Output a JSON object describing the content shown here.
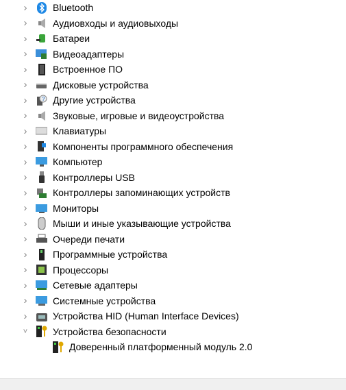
{
  "tree": {
    "categories": [
      {
        "label": "Bluetooth",
        "icon": "bluetooth-icon",
        "expanded": false
      },
      {
        "label": "Аудиовходы и аудиовыходы",
        "icon": "speaker-icon",
        "expanded": false
      },
      {
        "label": "Батареи",
        "icon": "battery-icon",
        "expanded": false
      },
      {
        "label": "Видеоадаптеры",
        "icon": "display-adapter-icon",
        "expanded": false
      },
      {
        "label": "Встроенное ПО",
        "icon": "firmware-chip-icon",
        "expanded": false
      },
      {
        "label": "Дисковые устройства",
        "icon": "disk-drive-icon",
        "expanded": false
      },
      {
        "label": "Другие устройства",
        "icon": "unknown-device-icon",
        "expanded": false
      },
      {
        "label": "Звуковые, игровые и видеоустройства",
        "icon": "speaker-icon",
        "expanded": false
      },
      {
        "label": "Клавиатуры",
        "icon": "keyboard-icon",
        "expanded": false
      },
      {
        "label": "Компоненты программного обеспечения",
        "icon": "software-component-icon",
        "expanded": false
      },
      {
        "label": "Компьютер",
        "icon": "computer-icon",
        "expanded": false
      },
      {
        "label": "Контроллеры USB",
        "icon": "usb-icon",
        "expanded": false
      },
      {
        "label": "Контроллеры запоминающих устройств",
        "icon": "storage-controller-icon",
        "expanded": false
      },
      {
        "label": "Мониторы",
        "icon": "monitor-icon",
        "expanded": false
      },
      {
        "label": "Мыши и иные указывающие устройства",
        "icon": "mouse-icon",
        "expanded": false
      },
      {
        "label": "Очереди печати",
        "icon": "printer-icon",
        "expanded": false
      },
      {
        "label": "Программные устройства",
        "icon": "software-device-icon",
        "expanded": false
      },
      {
        "label": "Процессоры",
        "icon": "processor-icon",
        "expanded": false
      },
      {
        "label": "Сетевые адаптеры",
        "icon": "network-adapter-icon",
        "expanded": false
      },
      {
        "label": "Системные устройства",
        "icon": "system-device-icon",
        "expanded": false
      },
      {
        "label": "Устройства HID (Human Interface Devices)",
        "icon": "hid-icon",
        "expanded": false
      },
      {
        "label": "Устройства безопасности",
        "icon": "security-device-icon",
        "expanded": true,
        "children": [
          {
            "label": "Доверенный платформенный модуль 2.0",
            "icon": "security-device-icon"
          }
        ]
      }
    ]
  }
}
